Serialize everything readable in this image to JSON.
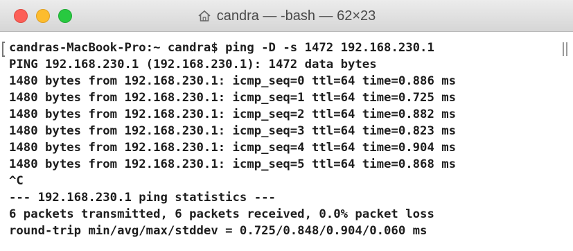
{
  "window": {
    "title": "candra — -bash — 62×23"
  },
  "terminal": {
    "lines": [
      "candras-MacBook-Pro:~ candra$ ping -D -s 1472 192.168.230.1",
      "PING 192.168.230.1 (192.168.230.1): 1472 data bytes",
      "1480 bytes from 192.168.230.1: icmp_seq=0 ttl=64 time=0.886 ms",
      "1480 bytes from 192.168.230.1: icmp_seq=1 ttl=64 time=0.725 ms",
      "1480 bytes from 192.168.230.1: icmp_seq=2 ttl=64 time=0.882 ms",
      "1480 bytes from 192.168.230.1: icmp_seq=3 ttl=64 time=0.823 ms",
      "1480 bytes from 192.168.230.1: icmp_seq=4 ttl=64 time=0.904 ms",
      "1480 bytes from 192.168.230.1: icmp_seq=5 ttl=64 time=0.868 ms",
      "^C",
      "--- 192.168.230.1 ping statistics ---",
      "6 packets transmitted, 6 packets received, 0.0% packet loss",
      "round-trip min/avg/max/stddev = 0.725/0.848/0.904/0.060 ms"
    ]
  },
  "icons": {
    "close": "close-button",
    "minimize": "minimize-button",
    "zoom": "zoom-button",
    "home": "home-icon"
  },
  "colors": {
    "close": "#fc5f57",
    "minimize": "#fdbc2e",
    "zoom": "#28c940",
    "text": "#1d1d1d"
  }
}
